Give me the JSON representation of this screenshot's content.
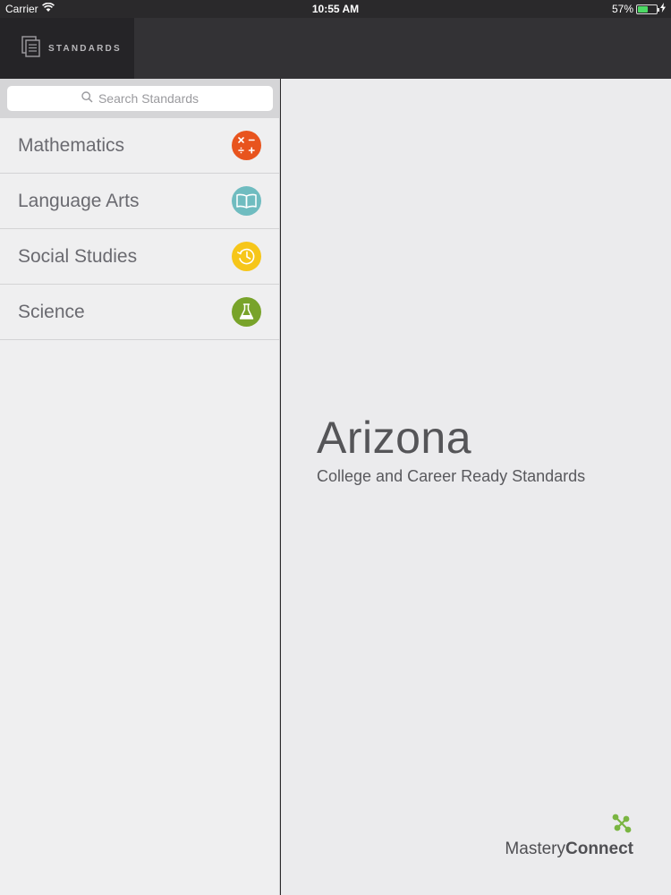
{
  "status_bar": {
    "carrier": "Carrier",
    "time": "10:55 AM",
    "battery_percent": "57%",
    "battery_level": 0.57
  },
  "nav": {
    "tab_label": "STANDARDS",
    "tab_icon": "document-stack-icon"
  },
  "sidebar": {
    "search_placeholder": "Search Standards",
    "subjects": [
      {
        "label": "Mathematics",
        "icon": "math-operators-icon",
        "color": "#e8541e"
      },
      {
        "label": "Language Arts",
        "icon": "open-book-icon",
        "color": "#6fbcc0"
      },
      {
        "label": "Social Studies",
        "icon": "clock-history-icon",
        "color": "#f6c619"
      },
      {
        "label": "Science",
        "icon": "flask-icon",
        "color": "#78a32a"
      }
    ]
  },
  "main": {
    "state": "Arizona",
    "subtitle": "College and Career Ready Standards",
    "logo_light": "Mastery",
    "logo_bold": "Connect",
    "logo_accent": "#7ab542"
  }
}
